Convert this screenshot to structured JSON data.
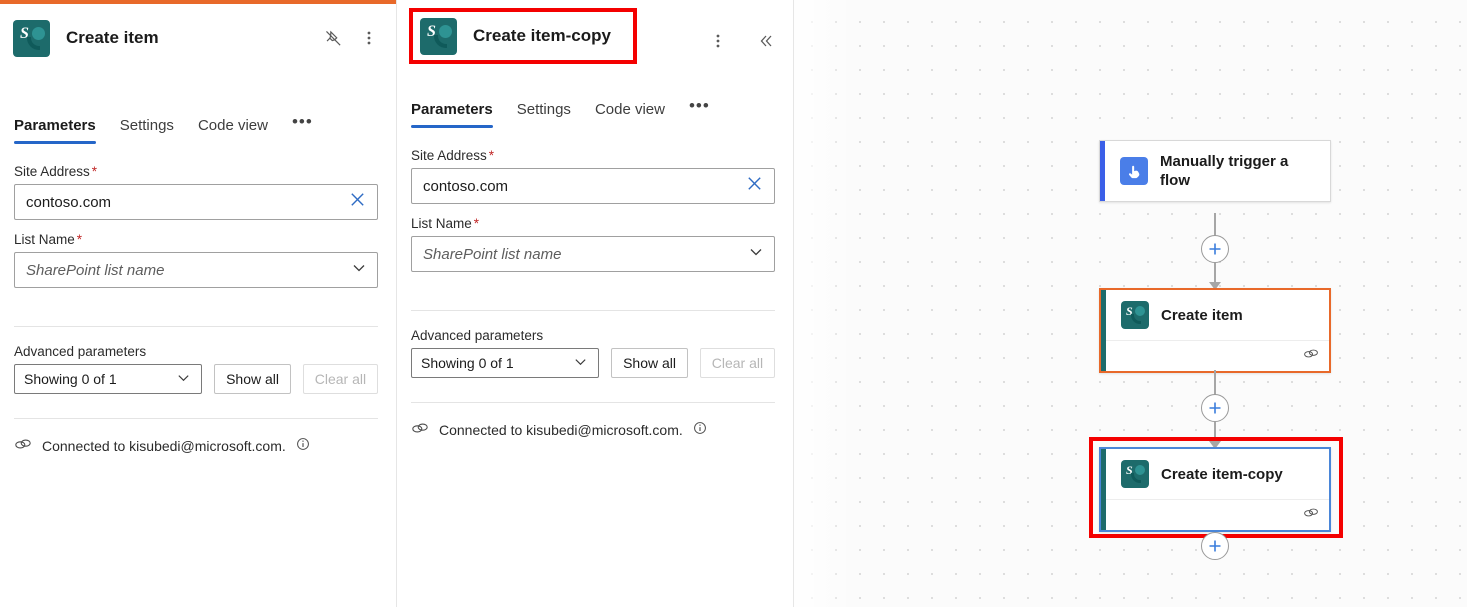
{
  "panels": [
    {
      "title": "Create item",
      "icon": "sharepoint-icon",
      "actions": [
        "unpin-icon",
        "more-vertical-icon"
      ],
      "tabs": [
        {
          "label": "Parameters",
          "active": true
        },
        {
          "label": "Settings",
          "active": false
        },
        {
          "label": "Code view",
          "active": false
        },
        {
          "label": "•••",
          "active": false
        }
      ],
      "fields": [
        {
          "label": "Site Address",
          "required": "*",
          "value": "contoso.com",
          "placeholder": "",
          "control": "text-with-clear"
        },
        {
          "label": "List Name",
          "required": "*",
          "value": "",
          "placeholder": "SharePoint list name",
          "control": "dropdown"
        }
      ],
      "advanced": {
        "label": "Advanced parameters",
        "select_value": "Showing 0 of 1",
        "show_all_label": "Show all",
        "clear_all_label": "Clear all"
      },
      "connection": {
        "text": "Connected to kisubedi@microsoft.com.",
        "link_icon": "link-icon",
        "info_icon": "info-icon"
      }
    },
    {
      "title": "Create item-copy",
      "icon": "sharepoint-icon",
      "actions": [
        "more-vertical-icon",
        "collapse-chevrons-icon"
      ],
      "tabs": [
        {
          "label": "Parameters",
          "active": true
        },
        {
          "label": "Settings",
          "active": false
        },
        {
          "label": "Code view",
          "active": false
        },
        {
          "label": "•••",
          "active": false
        }
      ],
      "fields": [
        {
          "label": "Site Address",
          "required": "*",
          "value": "contoso.com",
          "placeholder": "",
          "control": "text-with-clear"
        },
        {
          "label": "List Name",
          "required": "*",
          "value": "",
          "placeholder": "SharePoint list name",
          "control": "dropdown"
        }
      ],
      "advanced": {
        "label": "Advanced parameters",
        "select_value": "Showing 0 of 1",
        "show_all_label": "Show all",
        "clear_all_label": "Clear all"
      },
      "connection": {
        "text": "Connected to kisubedi@microsoft.com.",
        "link_icon": "link-icon",
        "info_icon": "info-icon"
      }
    }
  ],
  "canvas": {
    "nodes": [
      {
        "label": "Manually trigger a flow",
        "icon": "manual-trigger-icon",
        "accent_color": "#3b5fe8",
        "selection": "none",
        "has_footer": false,
        "annotated": false
      },
      {
        "label": "Create item",
        "icon": "sharepoint-icon",
        "accent_color": "#1d6b6b",
        "selection": "orange",
        "has_footer": true,
        "annotated": false
      },
      {
        "label": "Create item-copy",
        "icon": "sharepoint-icon",
        "accent_color": "#1d6b6b",
        "selection": "blue",
        "has_footer": true,
        "annotated": true
      }
    ],
    "add_buttons": 3,
    "add_button_label": "+"
  },
  "colors": {
    "accent_orange": "#e8692a",
    "annotation_red": "#f40000",
    "tab_underline_blue": "#2566c8",
    "sharepoint_teal": "#1d6b6b",
    "trigger_blue": "#4a7ee8"
  }
}
